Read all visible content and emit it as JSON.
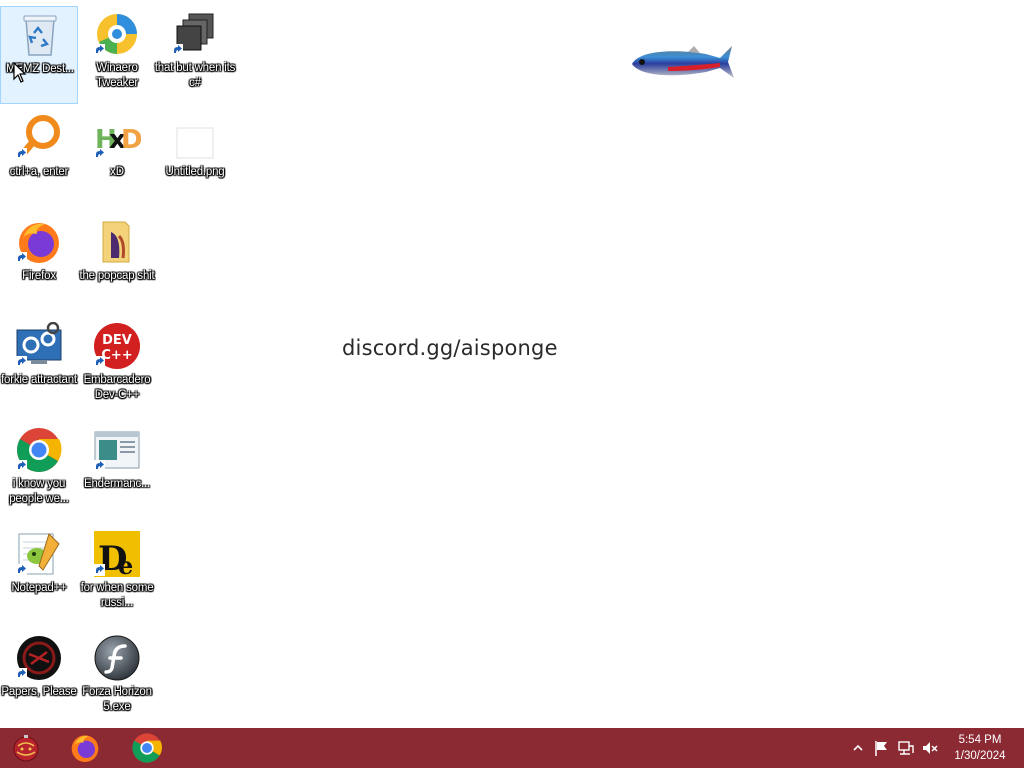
{
  "desktop": {
    "wallpaper_text": "discord.gg/aisponge",
    "icons": [
      {
        "id": "recycle",
        "label": "MEMZ Dest...",
        "icon": "recycle-bin-icon"
      },
      {
        "id": "winaero",
        "label": "Winaero Tweaker",
        "icon": "winaero-tweaker-icon"
      },
      {
        "id": "thatbut",
        "label": "that but when its c#",
        "icon": "stacked-windows-icon"
      },
      {
        "id": "ctrla",
        "label": "ctrl+a, enter",
        "icon": "magnifier-icon"
      },
      {
        "id": "xd",
        "label": "xD",
        "icon": "hxd-hex-editor-icon"
      },
      {
        "id": "untitled",
        "label": "Untitled.png",
        "icon": "blank-image-icon"
      },
      {
        "id": "firefox",
        "label": "Firefox",
        "icon": "firefox-icon"
      },
      {
        "id": "popcap",
        "label": "the popcap shit",
        "icon": "folder-icon"
      },
      {
        "id": "forkie",
        "label": "forkie attractant",
        "icon": "computer-settings-icon"
      },
      {
        "id": "devcpp",
        "label": "Embarcadero Dev-C++",
        "icon": "dev-cpp-icon"
      },
      {
        "id": "chrome",
        "label": "i know you people we...",
        "icon": "chrome-icon"
      },
      {
        "id": "enderman",
        "label": "Endermanc...",
        "icon": "window-app-icon"
      },
      {
        "id": "notepadpp",
        "label": "Notepad++",
        "icon": "notepad-plus-plus-icon"
      },
      {
        "id": "de",
        "label": "for when some russi...",
        "icon": "de-yellow-icon"
      },
      {
        "id": "papers",
        "label": "Papers, Please",
        "icon": "papers-please-icon"
      },
      {
        "id": "forza",
        "label": "Forza Horizon 5.exe",
        "icon": "flash-player-icon"
      }
    ]
  },
  "taskbar": {
    "start_icon": "start-ornament-icon",
    "pinned": [
      {
        "label": "Firefox",
        "icon": "firefox-icon"
      },
      {
        "label": "Google Chrome",
        "icon": "chrome-icon"
      }
    ],
    "tray": {
      "icons": [
        "chevron-up-icon",
        "flag-icon",
        "network-icon",
        "volume-muted-icon"
      ],
      "time": "5:54 PM",
      "date": "1/30/2024"
    }
  },
  "colors": {
    "taskbar": "#8c2a34",
    "desktop_background": "#ffffff"
  }
}
